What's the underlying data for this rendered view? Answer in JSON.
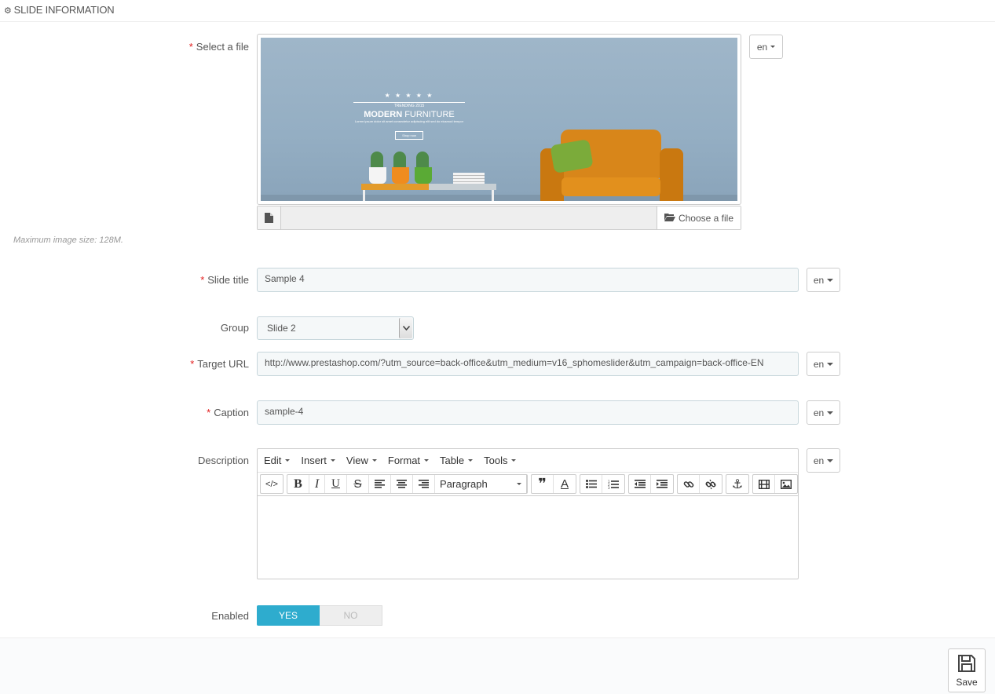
{
  "panel": {
    "title": "SLIDE INFORMATION",
    "icon": "gears-icon"
  },
  "file": {
    "label": "Select a file",
    "lang": "en",
    "choose_label": "Choose a file",
    "hint": "Maximum image size: 128M.",
    "preview": {
      "tagline": "TRENDING 2015",
      "headline_bold": "MODERN",
      "headline_rest": " FURNITURE",
      "body": "Lorem ipsum dolor sit amet consectetur adipiscing elit sed do eiusmod tempor",
      "cta": "Shop now"
    }
  },
  "slide_title": {
    "label": "Slide title",
    "value": "Sample 4",
    "lang": "en"
  },
  "group": {
    "label": "Group",
    "value": "Slide 2"
  },
  "target_url": {
    "label": "Target URL",
    "value": "http://www.prestashop.com/?utm_source=back-office&utm_medium=v16_sphomeslider&utm_campaign=back-office-EN",
    "lang": "en"
  },
  "caption": {
    "label": "Caption",
    "value": "sample-4",
    "lang": "en"
  },
  "description": {
    "label": "Description",
    "lang": "en",
    "menus": [
      "Edit",
      "Insert",
      "View",
      "Format",
      "Table",
      "Tools"
    ],
    "format_select": "Paragraph"
  },
  "enabled": {
    "label": "Enabled",
    "yes": "YES",
    "no": "NO"
  },
  "footer": {
    "save_label": "Save"
  },
  "colors": {
    "accent": "#2eacce",
    "required": "#e31d1d",
    "field_bg": "#f5f8f9"
  }
}
